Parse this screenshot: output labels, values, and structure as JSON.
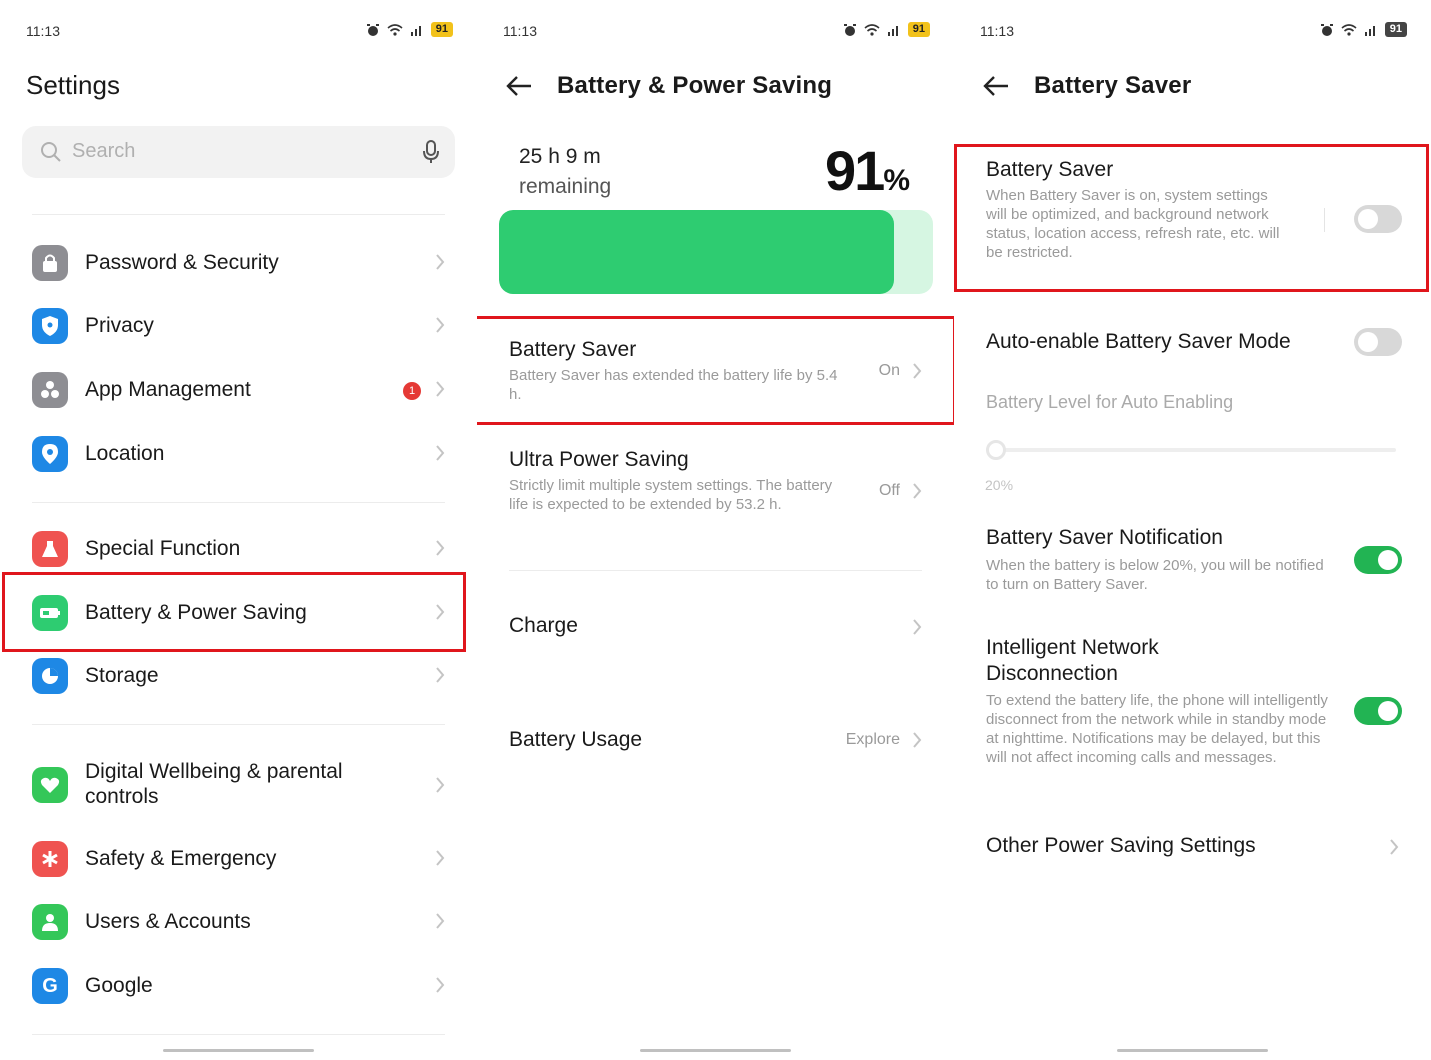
{
  "status": {
    "time": "11:13",
    "battery": "91"
  },
  "p1": {
    "title": "Settings",
    "search_placeholder": "Search",
    "items": [
      {
        "label": "Password & Security",
        "icon": "lock-icon",
        "color": "#8e8e93"
      },
      {
        "label": "Privacy",
        "icon": "shield-icon",
        "color": "#1e88e5"
      },
      {
        "label": "App Management",
        "icon": "apps-icon",
        "color": "#8e8e93",
        "badge": "1"
      },
      {
        "label": "Location",
        "icon": "location-pin-icon",
        "color": "#1e88e5"
      },
      {
        "label": "Special Function",
        "icon": "flask-icon",
        "color": "#ef5350"
      },
      {
        "label": "Battery & Power Saving",
        "icon": "battery-icon",
        "color": "#2ecc71"
      },
      {
        "label": "Storage",
        "icon": "pie-chart-icon",
        "color": "#1e88e5"
      },
      {
        "label_line1": "Digital Wellbeing & parental",
        "label_line2": "controls",
        "icon": "heart-icon",
        "color": "#34c759"
      },
      {
        "label": "Safety & Emergency",
        "icon": "asterisk-icon",
        "color": "#ef5350"
      },
      {
        "label": "Users & Accounts",
        "icon": "person-icon",
        "color": "#34c759"
      },
      {
        "label": "Google",
        "icon": "google-icon",
        "color": "#1e88e5"
      }
    ]
  },
  "p2": {
    "title": "Battery & Power Saving",
    "time_remaining": "25 h 9 m",
    "remaining_label": "remaining",
    "percent": "91",
    "percent_sign": "%",
    "level": 0.91,
    "options": [
      {
        "title": "Battery Saver",
        "desc": "Battery Saver has extended the battery life by 5.4 h.",
        "value": "On"
      },
      {
        "title": "Ultra Power Saving",
        "desc": "Strictly limit multiple system settings. The battery life is expected to be extended by 53.2 h.",
        "value": "Off"
      },
      {
        "title": "Charge"
      },
      {
        "title": "Battery Usage",
        "value": "Explore"
      }
    ]
  },
  "p3": {
    "title": "Battery Saver",
    "saver": {
      "title": "Battery Saver",
      "desc": "When Battery Saver is on, system settings will be optimized, and background network status, location access, refresh rate, etc. will be restricted.",
      "on": false
    },
    "auto_enable": {
      "title": "Auto-enable Battery Saver Mode",
      "on": false
    },
    "level_label": "Battery Level for Auto Enabling",
    "level_value": "20%",
    "notification": {
      "title": "Battery Saver Notification",
      "desc": "When the battery is below 20%, you will be notified to turn on Battery Saver.",
      "on": true
    },
    "network": {
      "title_line1": "Intelligent Network",
      "title_line2": "Disconnection",
      "desc": "To extend the battery life, the phone will intelligently disconnect from the network while in standby mode at nighttime. Notifications may be delayed, but this will not affect incoming calls and messages.",
      "on": true
    },
    "other": "Other Power Saving Settings"
  },
  "colors": {
    "highlight": "#e0161c",
    "toggle_on": "#22b453",
    "battery_fill": "#2ecc71",
    "battery_track": "#d6f6e2"
  }
}
